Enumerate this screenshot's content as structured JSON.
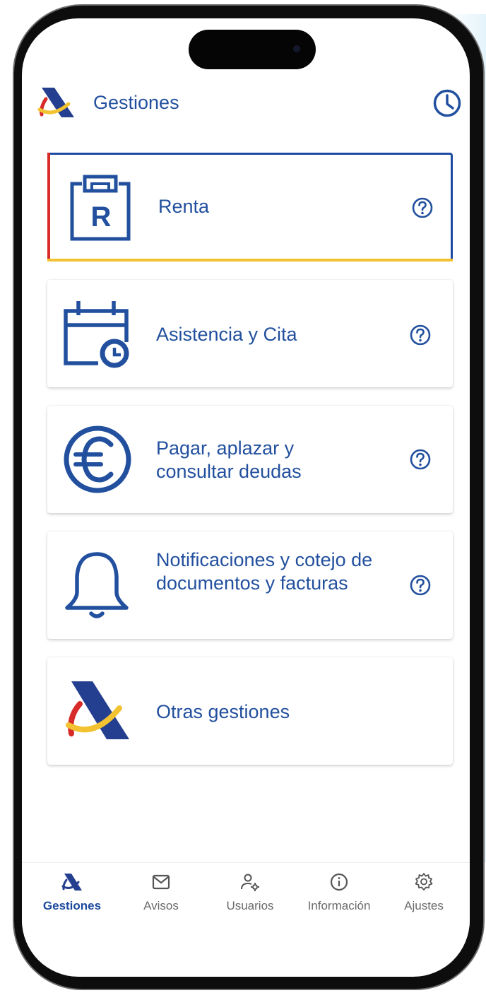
{
  "header": {
    "title": "Gestiones",
    "logo_icon": "aeat-logo-icon",
    "history_icon": "clock-icon"
  },
  "cards": [
    {
      "label": "Renta",
      "icon": "renta-document-icon",
      "help_icon": "help-icon",
      "selected": true
    },
    {
      "label": "Asistencia y Cita",
      "icon": "calendar-clock-icon",
      "help_icon": "help-icon"
    },
    {
      "label": "Pagar, aplazar y consultar deudas",
      "icon": "euro-icon",
      "help_icon": "help-icon"
    },
    {
      "label": "Notificaciones y cotejo de documentos y facturas",
      "icon": "bell-icon",
      "help_icon": "help-icon"
    },
    {
      "label": "Otras gestiones",
      "icon": "aeat-logo-icon"
    }
  ],
  "tabs": [
    {
      "label": "Gestiones",
      "icon": "aeat-logo-icon",
      "active": true
    },
    {
      "label": "Avisos",
      "icon": "mail-icon"
    },
    {
      "label": "Usuarios",
      "icon": "user-settings-icon"
    },
    {
      "label": "Información",
      "icon": "info-icon"
    },
    {
      "label": "Ajustes",
      "icon": "gear-icon"
    }
  ],
  "colors": {
    "primary": "#22509e",
    "accent_red": "#d62b28",
    "accent_yellow": "#f2c230",
    "inactive": "#6a6a6a"
  }
}
